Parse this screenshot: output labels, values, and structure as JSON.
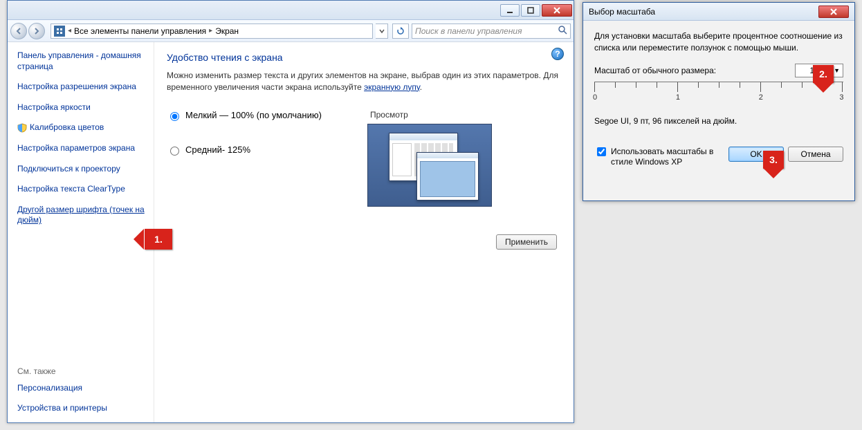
{
  "window": {
    "breadcrumb": {
      "root": "Все элементы панели управления",
      "current": "Экран"
    },
    "search_placeholder": "Поиск в панели управления"
  },
  "sidebar": {
    "home": "Панель управления - домашняя страница",
    "links": {
      "resolution": "Настройка разрешения экрана",
      "brightness": "Настройка яркости",
      "calibration": "Калибровка цветов",
      "params": "Настройка параметров экрана",
      "projector": "Подключиться к проектору",
      "cleartype": "Настройка текста ClearType",
      "dpi": "Другой размер шрифта (точек на дюйм)"
    },
    "also_header": "См. также",
    "also": {
      "personalization": "Персонализация",
      "devices": "Устройства и принтеры"
    }
  },
  "content": {
    "title": "Удобство чтения с экрана",
    "desc_before": "Можно изменить размер текста и других элементов на экране, выбрав один из этих параметров. Для временного увеличения части экрана используйте ",
    "desc_link": "экранную лупу",
    "desc_after": ".",
    "radio_small": "Мелкий — 100% (по умолчанию)",
    "radio_medium": "Средний- 125%",
    "preview_label": "Просмотр",
    "apply": "Применить"
  },
  "callouts": {
    "one": "1.",
    "two": "2.",
    "three": "3."
  },
  "dialog": {
    "title": "Выбор масштаба",
    "desc": "Для установки масштаба выберите процентное соотношение из списка или переместите ползунок с помощью мыши.",
    "scale_label": "Масштаб от обычного размера:",
    "scale_value": "100%",
    "ruler_labels": [
      "0",
      "1",
      "2",
      "3"
    ],
    "sample": "Segoe UI, 9 пт, 96 пикселей на дюйм.",
    "checkbox": "Использовать масштабы в стиле Windows XP",
    "ok": "OK",
    "cancel": "Отмена"
  }
}
